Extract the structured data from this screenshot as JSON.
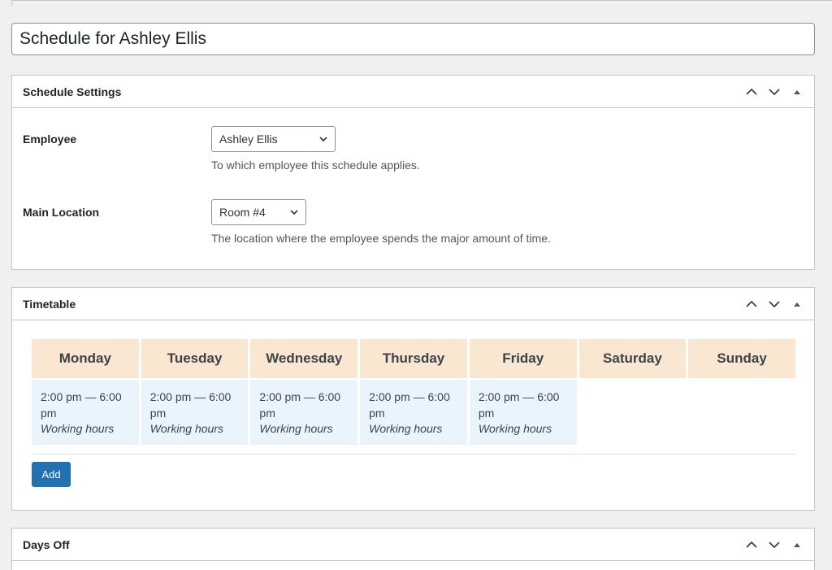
{
  "post": {
    "title": "Schedule for Ashley Ellis"
  },
  "settings_box": {
    "title": "Schedule Settings",
    "employee": {
      "label": "Employee",
      "selected": "Ashley Ellis",
      "description": "To which employee this schedule applies."
    },
    "location": {
      "label": "Main Location",
      "selected": "Room #4",
      "description": "The location where the employee spends the major amount of time."
    }
  },
  "timetable_box": {
    "title": "Timetable",
    "days": [
      "Monday",
      "Tuesday",
      "Wednesday",
      "Thursday",
      "Friday",
      "Saturday",
      "Sunday"
    ],
    "slots": [
      {
        "time": "2:00 pm — 6:00 pm",
        "type": "Working hours"
      },
      {
        "time": "2:00 pm — 6:00 pm",
        "type": "Working hours"
      },
      {
        "time": "2:00 pm — 6:00 pm",
        "type": "Working hours"
      },
      {
        "time": "2:00 pm — 6:00 pm",
        "type": "Working hours"
      },
      {
        "time": "2:00 pm — 6:00 pm",
        "type": "Working hours"
      }
    ],
    "add_label": "Add"
  },
  "daysoff_box": {
    "title": "Days Off"
  },
  "icons": {
    "move_up": "chevron-up-icon",
    "move_down": "chevron-down-icon",
    "toggle": "triangle-up-icon"
  },
  "colors": {
    "header_cell": "#f9e7d2",
    "slot_cell": "#eaf4fd",
    "primary_button": "#2271b1"
  }
}
